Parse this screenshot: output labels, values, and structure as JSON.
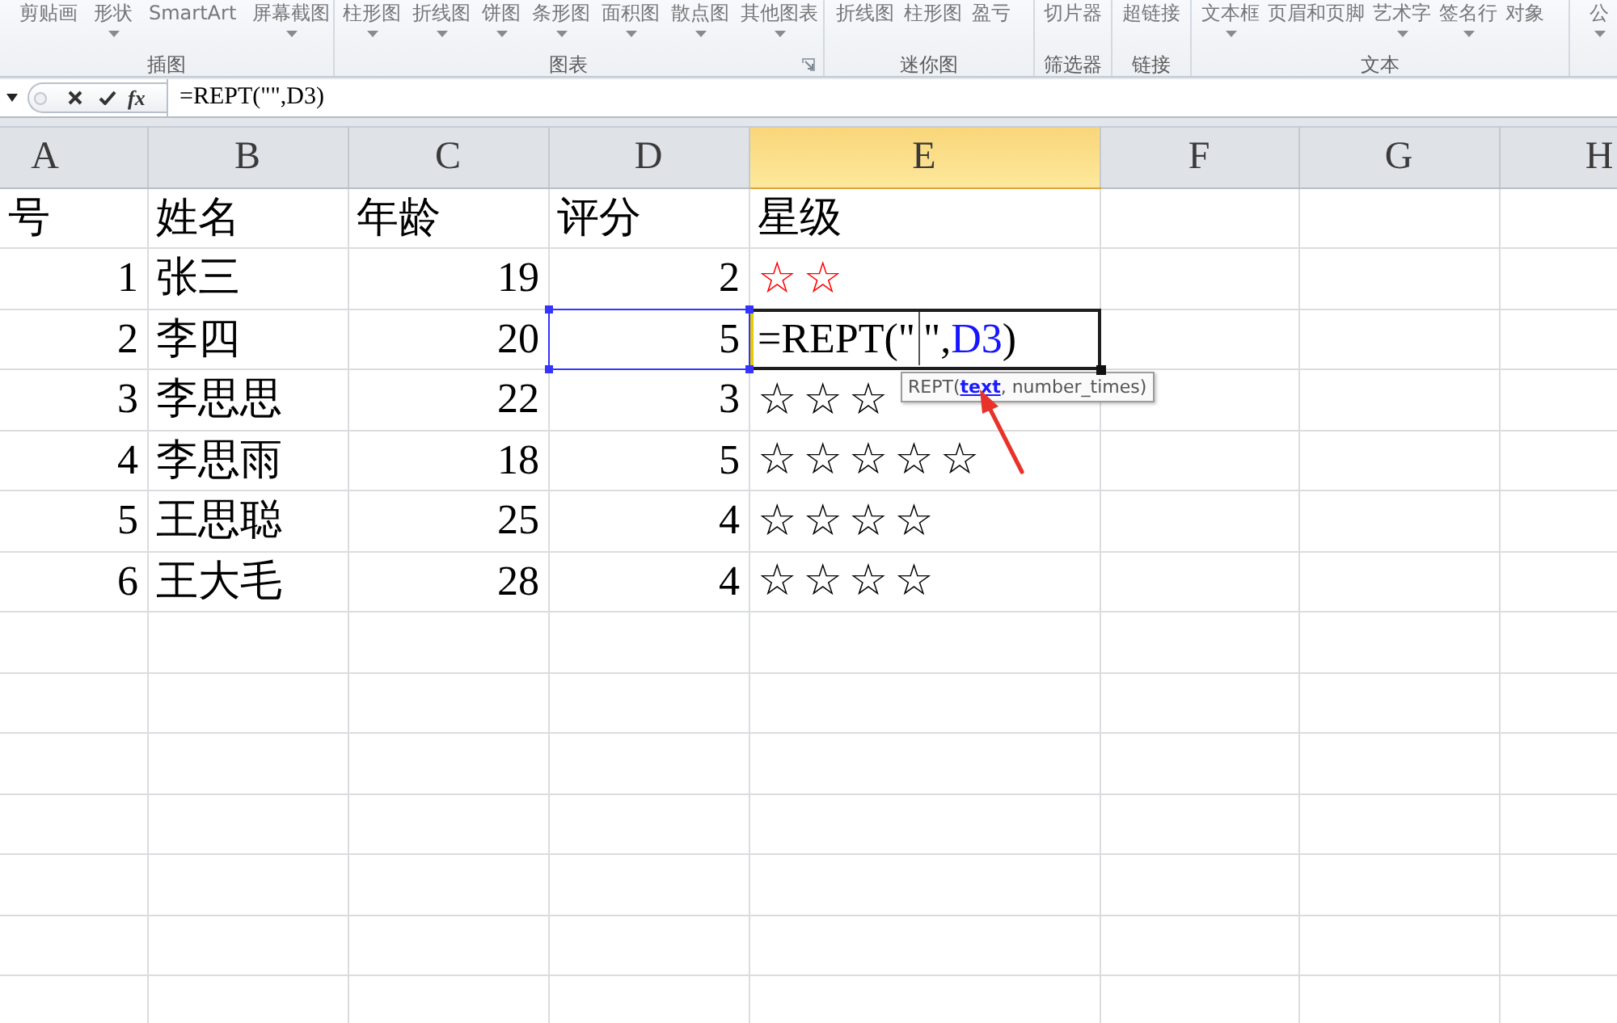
{
  "ribbon": {
    "groups": [
      {
        "label": "插图",
        "launcher": false,
        "items": [
          {
            "label": "剪贴画",
            "has_menu": false
          },
          {
            "label": "形状",
            "has_menu": true
          },
          {
            "label": "SmartArt",
            "has_menu": false
          },
          {
            "label": "屏幕截图",
            "has_menu": true
          }
        ]
      },
      {
        "label": "图表",
        "launcher": true,
        "items": [
          {
            "label": "柱形图",
            "has_menu": true
          },
          {
            "label": "折线图",
            "has_menu": true
          },
          {
            "label": "饼图",
            "has_menu": true
          },
          {
            "label": "条形图",
            "has_menu": true
          },
          {
            "label": "面积图",
            "has_menu": true
          },
          {
            "label": "散点图",
            "has_menu": true
          },
          {
            "label": "其他图表",
            "has_menu": true
          }
        ]
      },
      {
        "label": "迷你图",
        "launcher": false,
        "items": [
          {
            "label": "折线图",
            "has_menu": false
          },
          {
            "label": "柱形图",
            "has_menu": false
          },
          {
            "label": "盈亏",
            "has_menu": false
          }
        ]
      },
      {
        "label": "筛选器",
        "launcher": false,
        "items": [
          {
            "label": "切片器",
            "has_menu": false
          }
        ]
      },
      {
        "label": "链接",
        "launcher": false,
        "items": [
          {
            "label": "超链接",
            "has_menu": false
          }
        ]
      },
      {
        "label": "文本",
        "launcher": false,
        "items": [
          {
            "label": "文本框",
            "has_menu": true
          },
          {
            "label": "页眉和页脚",
            "has_menu": false
          },
          {
            "label": "艺术字",
            "has_menu": true
          },
          {
            "label": "签名行",
            "has_menu": true
          },
          {
            "label": "对象",
            "has_menu": false
          }
        ]
      },
      {
        "launcher": false,
        "items": [
          {
            "label": "公",
            "has_menu": true
          }
        ]
      }
    ]
  },
  "formula_bar": {
    "function_button": "fx",
    "formula": "=REPT(\"\",D3)"
  },
  "sheet": {
    "columns": [
      {
        "letter": "A",
        "selected": false
      },
      {
        "letter": "B",
        "selected": false
      },
      {
        "letter": "C",
        "selected": false
      },
      {
        "letter": "D",
        "selected": false
      },
      {
        "letter": "E",
        "selected": true
      },
      {
        "letter": "F",
        "selected": false
      },
      {
        "letter": "G",
        "selected": false
      },
      {
        "letter": "H",
        "selected": false
      }
    ],
    "rows": [
      {
        "cells": [
          {
            "kind": "text",
            "text": "号",
            "referenced": false
          },
          {
            "kind": "text",
            "text": "姓名",
            "referenced": false
          },
          {
            "kind": "text",
            "text": "年龄",
            "referenced": false
          },
          {
            "kind": "text",
            "text": "评分",
            "referenced": false
          },
          {
            "kind": "text",
            "text": "星级",
            "referenced": false
          }
        ]
      },
      {
        "cells": [
          {
            "kind": "number",
            "text": "1",
            "referenced": false
          },
          {
            "kind": "text",
            "text": "张三",
            "referenced": false
          },
          {
            "kind": "number",
            "text": "19",
            "referenced": false
          },
          {
            "kind": "number",
            "text": "2",
            "referenced": false
          },
          {
            "kind": "stars",
            "text": "☆☆",
            "color": "#ff0000",
            "referenced": false
          }
        ]
      },
      {
        "cells": [
          {
            "kind": "number",
            "text": "2",
            "referenced": false
          },
          {
            "kind": "text",
            "text": "李四",
            "referenced": false
          },
          {
            "kind": "number",
            "text": "20",
            "referenced": false
          },
          {
            "kind": "number",
            "text": "5",
            "referenced": true
          },
          {
            "kind": "editing",
            "referenced": false,
            "before_cursor": "=REPT(\"",
            "after_cursor": "\",",
            "reference": "D3",
            "after_reference": ")",
            "hint": {
              "function": "REPT(",
              "argument": "text",
              "rest": ", number_times)"
            }
          }
        ]
      },
      {
        "cells": [
          {
            "kind": "number",
            "text": "3",
            "referenced": false
          },
          {
            "kind": "text",
            "text": "李思思",
            "referenced": false
          },
          {
            "kind": "number",
            "text": "22",
            "referenced": false
          },
          {
            "kind": "number",
            "text": "3",
            "referenced": false
          },
          {
            "kind": "stars",
            "text": "☆☆☆",
            "referenced": false
          }
        ]
      },
      {
        "cells": [
          {
            "kind": "number",
            "text": "4",
            "referenced": false
          },
          {
            "kind": "text",
            "text": "李思雨",
            "referenced": false
          },
          {
            "kind": "number",
            "text": "18",
            "referenced": false
          },
          {
            "kind": "number",
            "text": "5",
            "referenced": false
          },
          {
            "kind": "stars",
            "text": "☆☆☆☆☆",
            "referenced": false
          }
        ]
      },
      {
        "cells": [
          {
            "kind": "number",
            "text": "5",
            "referenced": false
          },
          {
            "kind": "text",
            "text": "王思聪",
            "referenced": false
          },
          {
            "kind": "number",
            "text": "25",
            "referenced": false
          },
          {
            "kind": "number",
            "text": "4",
            "referenced": false
          },
          {
            "kind": "stars",
            "text": "☆☆☆☆",
            "referenced": false
          }
        ]
      },
      {
        "cells": [
          {
            "kind": "number",
            "text": "6",
            "referenced": false
          },
          {
            "kind": "text",
            "text": "王大毛",
            "referenced": false
          },
          {
            "kind": "number",
            "text": "28",
            "referenced": false
          },
          {
            "kind": "number",
            "text": "4",
            "referenced": false
          },
          {
            "kind": "stars",
            "text": "☆☆☆☆",
            "referenced": false
          }
        ]
      }
    ]
  }
}
